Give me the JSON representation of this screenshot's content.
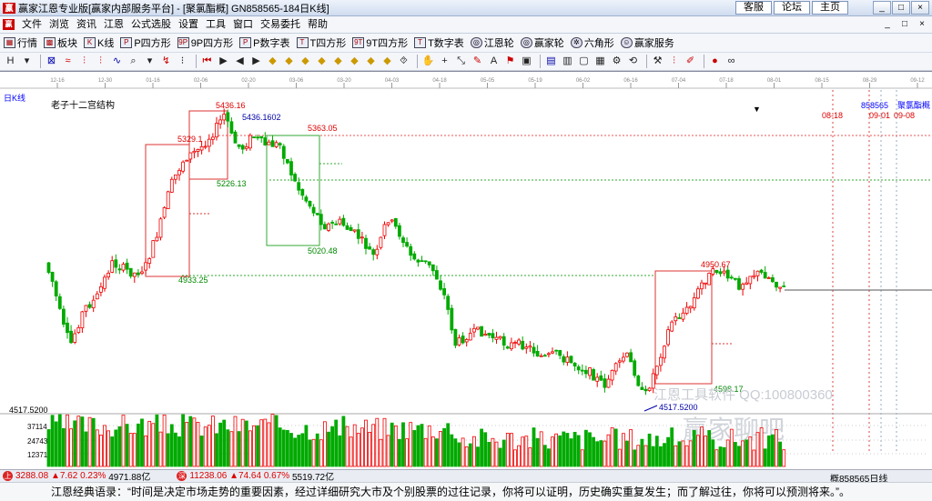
{
  "window": {
    "title": "赢家江恩专业版[赢家内部服务平台] - [聚氯酯概]  GN858565-184日K线]",
    "links": [
      "客服",
      "论坛",
      "主页"
    ],
    "controls": [
      "_",
      "□",
      "×"
    ]
  },
  "menu": {
    "logo": "赢",
    "items": [
      "文件",
      "浏览",
      "资讯",
      "江恩",
      "公式选股",
      "设置",
      "工具",
      "窗口",
      "交易委托",
      "帮助"
    ],
    "mdi": [
      "_",
      "□",
      "×"
    ]
  },
  "toolbar1": [
    {
      "icon": "grid-icon",
      "glyph": "▦",
      "label": "行情"
    },
    {
      "icon": "block-icon",
      "glyph": "▩",
      "label": "板块"
    },
    {
      "icon": "kline-icon",
      "glyph": "K",
      "label": "K线"
    },
    {
      "icon": "p-square-icon",
      "glyph": "P",
      "label": "P四方形"
    },
    {
      "icon": "9p-square-icon",
      "glyph": "9P",
      "label": "9P四方形"
    },
    {
      "icon": "p-table-icon",
      "glyph": "P",
      "label": "P数字表"
    },
    {
      "icon": "t-square-icon",
      "glyph": "T",
      "label": "T四方形"
    },
    {
      "icon": "9t-square-icon",
      "glyph": "9T",
      "label": "9T四方形"
    },
    {
      "icon": "t-table-icon",
      "glyph": "T",
      "label": "T数字表"
    },
    {
      "icon": "gann-wheel-icon",
      "glyph": "◎",
      "label": "江恩轮"
    },
    {
      "icon": "winner-wheel-icon",
      "glyph": "◎",
      "label": "赢家轮"
    },
    {
      "icon": "hexagon-icon",
      "glyph": "✲",
      "label": "六角形"
    },
    {
      "icon": "service-icon",
      "glyph": "☺",
      "label": "赢家服务"
    }
  ],
  "toolbar2": [
    {
      "icon": "chart-type-icon",
      "glyph": "H",
      "c": ""
    },
    {
      "icon": "dropdown-icon",
      "glyph": "▾",
      "c": ""
    },
    {
      "sep": true
    },
    {
      "icon": "indicator-icon",
      "glyph": "⊠",
      "c": "b"
    },
    {
      "icon": "wave-icon",
      "glyph": "≈",
      "c": "r"
    },
    {
      "icon": "bars-icon",
      "glyph": "⫶",
      "c": "r"
    },
    {
      "icon": "kbars-icon",
      "glyph": "⫶",
      "c": "r"
    },
    {
      "icon": "line-icon",
      "glyph": "∿",
      "c": "b"
    },
    {
      "icon": "zoom-icon",
      "glyph": "⌕",
      "c": ""
    },
    {
      "icon": "dropdown-icon",
      "glyph": "▾",
      "c": ""
    },
    {
      "icon": "trend-icon",
      "glyph": "↯",
      "c": "r"
    },
    {
      "icon": "dotbars-icon",
      "glyph": "⁝",
      "c": ""
    },
    {
      "sep": true
    },
    {
      "icon": "first-icon",
      "glyph": "⏮",
      "c": "r"
    },
    {
      "icon": "back-icon",
      "glyph": "▶",
      "c": ""
    },
    {
      "icon": "prev-icon",
      "glyph": "◀",
      "c": ""
    },
    {
      "icon": "next-icon",
      "glyph": "▶",
      "c": ""
    },
    {
      "icon": "diamond-icon",
      "glyph": "◆",
      "c": "y"
    },
    {
      "icon": "diamond-icon",
      "glyph": "◆",
      "c": "y"
    },
    {
      "icon": "diamond-icon",
      "glyph": "◆",
      "c": "y"
    },
    {
      "icon": "diamond-icon",
      "glyph": "◆",
      "c": "y"
    },
    {
      "icon": "diamond-icon",
      "glyph": "◆",
      "c": "y"
    },
    {
      "icon": "diamond-icon",
      "glyph": "◆",
      "c": "y"
    },
    {
      "icon": "diamond-icon",
      "glyph": "◆",
      "c": "y"
    },
    {
      "icon": "diamond-icon",
      "glyph": "◆",
      "c": "y"
    },
    {
      "icon": "mark-icon",
      "glyph": "⯑",
      "c": ""
    },
    {
      "sep": true
    },
    {
      "icon": "hand-icon",
      "glyph": "✋",
      "c": ""
    },
    {
      "icon": "cross-icon",
      "glyph": "+",
      "c": ""
    },
    {
      "icon": "arrow-icon",
      "glyph": "⤡",
      "c": ""
    },
    {
      "icon": "pen-icon",
      "glyph": "✎",
      "c": "r"
    },
    {
      "icon": "text-icon",
      "glyph": "A",
      "c": ""
    },
    {
      "icon": "flag-icon",
      "glyph": "⚑",
      "c": "r"
    },
    {
      "icon": "box-icon",
      "glyph": "▣",
      "c": ""
    },
    {
      "sep": true
    },
    {
      "icon": "save-icon",
      "glyph": "▤",
      "c": "b"
    },
    {
      "icon": "print-icon",
      "glyph": "▥",
      "c": ""
    },
    {
      "icon": "window-icon",
      "glyph": "▢",
      "c": ""
    },
    {
      "icon": "layout-icon",
      "glyph": "▦",
      "c": ""
    },
    {
      "icon": "gear-icon",
      "glyph": "⚙",
      "c": ""
    },
    {
      "icon": "sync-icon",
      "glyph": "⟲",
      "c": ""
    },
    {
      "sep": true
    },
    {
      "icon": "tool-icon",
      "glyph": "⚒",
      "c": ""
    },
    {
      "icon": "kchart-icon",
      "glyph": "⫶",
      "c": "r"
    },
    {
      "icon": "brush-icon",
      "glyph": "✐",
      "c": "r"
    },
    {
      "sep": true
    },
    {
      "icon": "palette-icon",
      "glyph": "●",
      "c": "r"
    },
    {
      "icon": "infinity-icon",
      "glyph": "∞",
      "c": ""
    }
  ],
  "chart": {
    "period_label": "日K线",
    "structure_title": "老子十二宫结构",
    "code_label": "858565",
    "name_label": "聚氯酯概",
    "date_ticks": [
      "12-16",
      "12-30",
      "01-16",
      "02-06",
      "02-20",
      "03-06",
      "03-20",
      "04-03",
      "04-18",
      "05-05",
      "05-19",
      "06-02",
      "06-16",
      "07-04",
      "07-18",
      "08-01",
      "08-15",
      "08-29",
      "09-12"
    ],
    "future_dates": [
      "08-18",
      "09-01",
      "09-08"
    ],
    "price_labels": [
      "5436.16",
      "5436.1602",
      "5329.1",
      "5226.13",
      "5363.05",
      "5020.48",
      "4933.25",
      "4950.67",
      "4598.17",
      "4517.5200"
    ],
    "axis_label": "4517.5200",
    "volume_ticks": [
      "37114",
      "24743",
      "12371"
    ],
    "watermark": "江恩工具软件  QQ:100800360",
    "watermark2": "赢家聊吧"
  },
  "chart_data": {
    "type": "candlestick",
    "title": "老子十二宫结构",
    "annotations": [
      5436.16,
      5329.1,
      5226.13,
      5363.05,
      5020.48,
      4933.25,
      4950.67,
      4598.17,
      4517.52
    ],
    "low": 4517.52,
    "high": 5436.16
  },
  "status": {
    "seg1_icon": "上",
    "seg1_value": "3288.08",
    "seg1_change": "▲7.62 0.23%",
    "seg1_amount": "4971.88亿",
    "seg2_icon": "深",
    "seg2_value": "11238.06",
    "seg2_change": "▲74.64 0.67%",
    "seg2_amount": "5519.72亿",
    "tail": "概858565日线"
  },
  "quote": "江恩经典语录：“时间是决定市场走势的重要因素，经过详细研究大市及个别股票的过往记录，你将可以证明，历史确实重复发生；而了解过往，你将可以预测将来。”。"
}
